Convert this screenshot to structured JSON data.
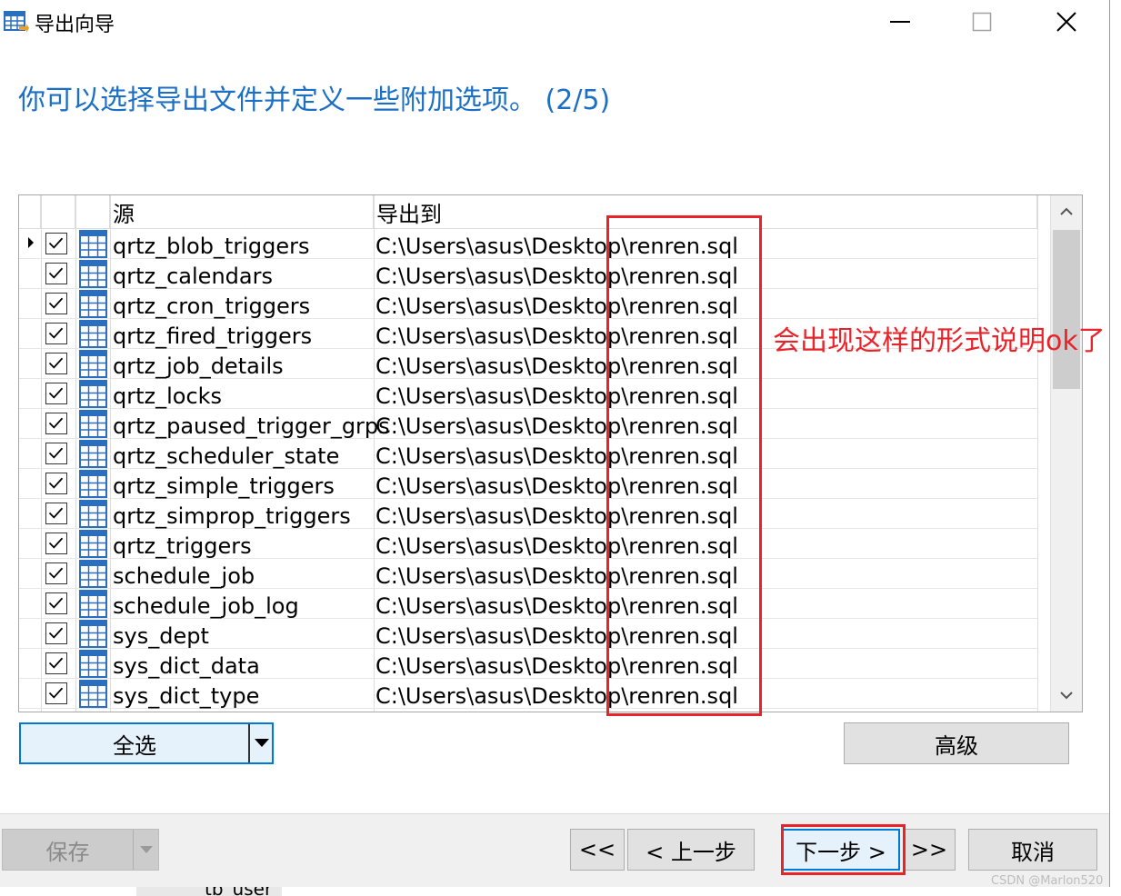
{
  "window": {
    "title": "导出向导"
  },
  "heading": "你可以选择导出文件并定义一些附加选项。 (2/5)",
  "grid": {
    "columns": {
      "source": "源",
      "target": "导出到"
    },
    "rows": [
      {
        "source": "qrtz_blob_triggers",
        "target": "C:\\Users\\asus\\Desktop\\renren.sql",
        "checked": true,
        "current": true
      },
      {
        "source": "qrtz_calendars",
        "target": "C:\\Users\\asus\\Desktop\\renren.sql",
        "checked": true
      },
      {
        "source": "qrtz_cron_triggers",
        "target": "C:\\Users\\asus\\Desktop\\renren.sql",
        "checked": true
      },
      {
        "source": "qrtz_fired_triggers",
        "target": "C:\\Users\\asus\\Desktop\\renren.sql",
        "checked": true
      },
      {
        "source": "qrtz_job_details",
        "target": "C:\\Users\\asus\\Desktop\\renren.sql",
        "checked": true
      },
      {
        "source": "qrtz_locks",
        "target": "C:\\Users\\asus\\Desktop\\renren.sql",
        "checked": true
      },
      {
        "source": "qrtz_paused_trigger_grps",
        "target": "C:\\Users\\asus\\Desktop\\renren.sql",
        "checked": true
      },
      {
        "source": "qrtz_scheduler_state",
        "target": "C:\\Users\\asus\\Desktop\\renren.sql",
        "checked": true
      },
      {
        "source": "qrtz_simple_triggers",
        "target": "C:\\Users\\asus\\Desktop\\renren.sql",
        "checked": true
      },
      {
        "source": "qrtz_simprop_triggers",
        "target": "C:\\Users\\asus\\Desktop\\renren.sql",
        "checked": true
      },
      {
        "source": "qrtz_triggers",
        "target": "C:\\Users\\asus\\Desktop\\renren.sql",
        "checked": true
      },
      {
        "source": "schedule_job",
        "target": "C:\\Users\\asus\\Desktop\\renren.sql",
        "checked": true
      },
      {
        "source": "schedule_job_log",
        "target": "C:\\Users\\asus\\Desktop\\renren.sql",
        "checked": true
      },
      {
        "source": "sys_dept",
        "target": "C:\\Users\\asus\\Desktop\\renren.sql",
        "checked": true
      },
      {
        "source": "sys_dict_data",
        "target": "C:\\Users\\asus\\Desktop\\renren.sql",
        "checked": true
      },
      {
        "source": "sys_dict_type",
        "target": "C:\\Users\\asus\\Desktop\\renren.sql",
        "checked": true
      }
    ]
  },
  "annotation": "会出现这样的形式说明ok了",
  "buttons": {
    "select_all": "全选",
    "advanced": "高级",
    "save": "保存",
    "first": "<<",
    "prev": "< 上一步",
    "next": "下一步 >",
    "last": ">>",
    "cancel": "取消"
  },
  "background_item": "tb_user",
  "watermark": "CSDN @Marlon520",
  "colors": {
    "accent": "#1b6fc4",
    "annotation": "#e8232a",
    "focus": "#0078d7"
  },
  "icons": [
    "app-icon",
    "minimize-icon",
    "maximize-icon",
    "close-icon",
    "table-icon",
    "checkbox-icon",
    "dropdown-arrow-icon",
    "scroll-up-icon",
    "scroll-down-icon",
    "row-indicator-icon"
  ]
}
